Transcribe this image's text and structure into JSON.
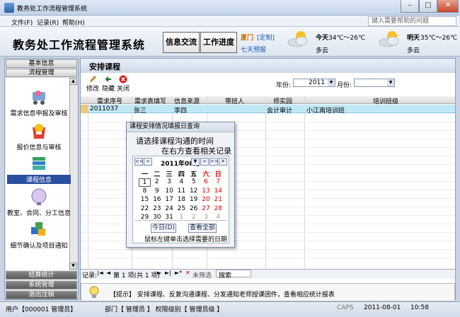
{
  "window": {
    "title": "教务处工作流程管理系统"
  },
  "menu": {
    "items": [
      "文件(F)",
      "记录(R)",
      "帮助(H)"
    ],
    "help_placeholder": "键入需要帮助的问题"
  },
  "header": {
    "app_title": "教务处工作流程管理系统",
    "btn_exchange": "信息交流",
    "btn_progress": "工作进度",
    "city": "厦门",
    "custom": "[定制]",
    "forecast": "七天预报",
    "today_label": "今天",
    "today_temp": "34℃～26℃",
    "today_desc": "多云",
    "tomorrow_label": "明天",
    "tomorrow_temp": "35℃～26℃",
    "tomorrow_desc": "多云"
  },
  "sidebar": {
    "top_items": [
      "基本信息",
      "流程管理"
    ],
    "modules": [
      "需求信息申报及审核",
      "报价信息与审核",
      "课程信息",
      "教室、合同、分工信息",
      "细节确认及项目通知"
    ],
    "selected_module": "课程信息",
    "bottom_items": [
      "结算统计",
      "系统管理",
      "退出注销"
    ]
  },
  "main": {
    "title": "安排课程",
    "toolbar": {
      "edit": "修改",
      "hide": "隐藏",
      "close": "关闭"
    },
    "year_label": "年份:",
    "year_value": "2011",
    "month_label": "月份:",
    "month_value": ""
  },
  "grid": {
    "columns": [
      "需求序号",
      "需求表填写",
      "信息来源",
      "带班人",
      "师实园",
      "培训班级"
    ],
    "rows": [
      [
        "2011037",
        "张三",
        "李四",
        "",
        "会计审计",
        "小江南培训班"
      ]
    ]
  },
  "nav": {
    "record_label": "记录:",
    "record_text": "第 1 项(共 1 项)",
    "filter": "未筛选",
    "search": "搜索"
  },
  "tip": {
    "text": "【提示】 安排课程、反复沟通课程、分发通知老师授课团件，查看相应统计报表"
  },
  "status": {
    "user": "用户【000001 管理员】",
    "dept": "部门【 管理员 】 权限级别【 管理员级 】",
    "caps": "CAPS",
    "date": "2011-08-01",
    "time": "10:58"
  },
  "dialog": {
    "title": "课程安排情况填报日查询",
    "line1": "请选择课程沟通的时间",
    "line2": "在右方查看相关记录",
    "month": "2011年08月",
    "weekdays": [
      "一",
      "二",
      "三",
      "四",
      "五",
      "六",
      "日"
    ],
    "weeks": [
      [
        "1",
        "2",
        "3",
        "4",
        "5",
        "6",
        "7"
      ],
      [
        "8",
        "9",
        "10",
        "11",
        "12",
        "13",
        "14"
      ],
      [
        "15",
        "16",
        "17",
        "18",
        "19",
        "20",
        "21"
      ],
      [
        "22",
        "23",
        "24",
        "25",
        "26",
        "27",
        "28"
      ],
      [
        "29",
        "30",
        "31",
        "1",
        "2",
        "3",
        "4"
      ]
    ],
    "today_btn": "今日(D)",
    "all_btn": "查看全部",
    "hint": "鼠标左键单击选择需要的日期"
  }
}
